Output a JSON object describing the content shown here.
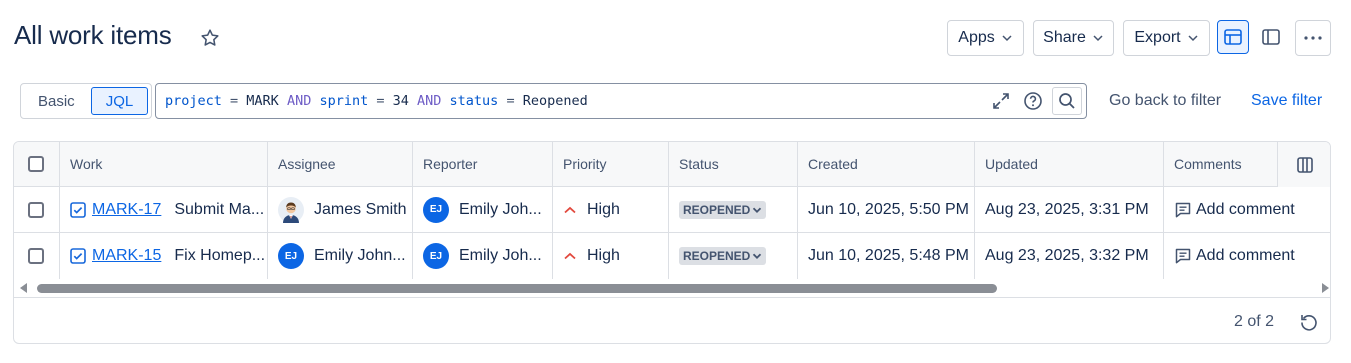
{
  "page": {
    "title": "All work items"
  },
  "toolbar": {
    "apps_label": "Apps",
    "share_label": "Share",
    "export_label": "Export"
  },
  "search": {
    "mode_basic": "Basic",
    "mode_jql": "JQL",
    "active_mode": "JQL",
    "query_tokens": [
      {
        "t": "project",
        "k": "field"
      },
      {
        "t": " = ",
        "k": "op"
      },
      {
        "t": "MARK",
        "k": "val"
      },
      {
        "t": " AND ",
        "k": "and"
      },
      {
        "t": "sprint",
        "k": "field"
      },
      {
        "t": " = ",
        "k": "op"
      },
      {
        "t": "34",
        "k": "val"
      },
      {
        "t": " AND ",
        "k": "and"
      },
      {
        "t": "status",
        "k": "field"
      },
      {
        "t": " = ",
        "k": "op"
      },
      {
        "t": "Reopened",
        "k": "val"
      }
    ],
    "go_back_label": "Go back to filter",
    "save_filter_label": "Save filter"
  },
  "table": {
    "columns": [
      "Work",
      "Assignee",
      "Reporter",
      "Priority",
      "Status",
      "Created",
      "Updated",
      "Comments"
    ],
    "rows": [
      {
        "key": "MARK-17",
        "summary": "Submit Ma...",
        "assignee": "James Smith",
        "assignee_avatar": "photo",
        "reporter": "Emily Joh...",
        "reporter_initials": "EJ",
        "priority": "High",
        "status": "REOPENED",
        "created": "Jun 10, 2025, 5:50 PM",
        "updated": "Aug 23, 2025, 3:31 PM",
        "comment": "Add comment"
      },
      {
        "key": "MARK-15",
        "summary": "Fix Homep...",
        "assignee": "Emily John...",
        "assignee_initials": "EJ",
        "reporter": "Emily Joh...",
        "reporter_initials": "EJ",
        "priority": "High",
        "status": "REOPENED",
        "created": "Jun 10, 2025, 5:48 PM",
        "updated": "Aug 23, 2025, 3:32 PM",
        "comment": "Add comment"
      }
    ]
  },
  "pagination": {
    "count_text": "2 of 2"
  },
  "colors": {
    "accent": "#0c66e4",
    "text": "#172b4d",
    "priority_high": "#e2483d"
  }
}
